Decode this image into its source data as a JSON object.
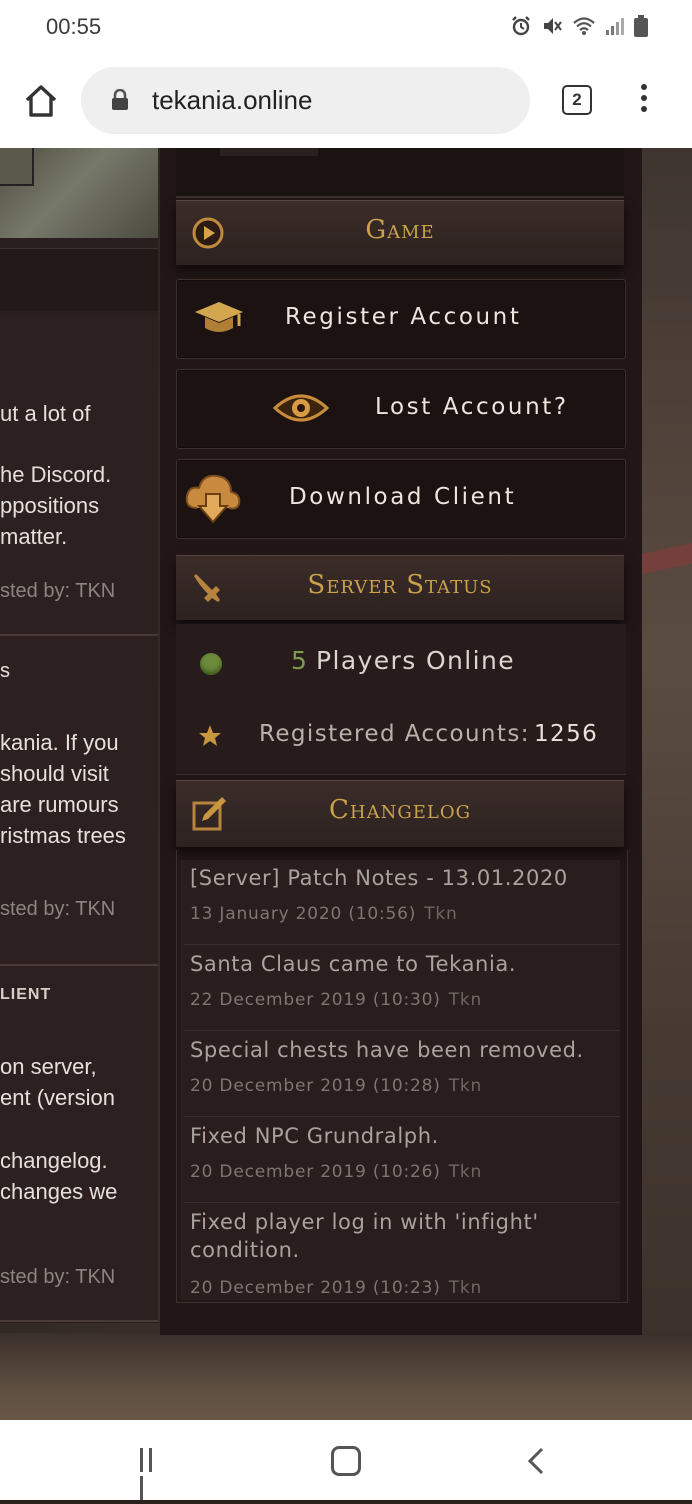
{
  "status_bar": {
    "time": "00:55",
    "icons": [
      "alarm-icon",
      "mute-icon",
      "wifi-icon",
      "signal-icon",
      "battery-icon"
    ]
  },
  "browser": {
    "url": "tekania.online",
    "tab_count": "2",
    "icons": [
      "home-icon",
      "lock-icon",
      "tabs-icon",
      "menu-icon"
    ]
  },
  "left_column": {
    "posts": [
      {
        "lines": [
          "ut a lot of",
          "he Discord.",
          "ppositions",
          " matter."
        ],
        "byline": "sted by: TKN"
      },
      {
        "title": "s",
        "lines": [
          "kania. If you",
          "should visit",
          "are rumours",
          "ristmas trees"
        ],
        "byline": "sted by: TKN"
      },
      {
        "title": "LIENT",
        "lines": [
          "on server,",
          "ent (version",
          "changelog.",
          "changes we"
        ],
        "byline": "sted by: TKN"
      }
    ]
  },
  "sidebar": {
    "game": {
      "title": "Game",
      "buttons": [
        {
          "label": "Register Account",
          "icon": "graduation-cap-icon"
        },
        {
          "label": "Lost Account?",
          "icon": "eye-icon"
        },
        {
          "label": "Download Client",
          "icon": "cloud-download-icon"
        }
      ]
    },
    "server_status": {
      "title": "Server Status",
      "players_count": "5",
      "players_label": "Players Online",
      "registered_label": "Registered Accounts:",
      "registered_count": "1256",
      "status_color": "#6b8a3a"
    },
    "changelog": {
      "title": "Changelog",
      "items": [
        {
          "title": "[Server] Patch Notes - 13.01.2020",
          "date": "13 January 2020 (10:56)",
          "author": "Tkn"
        },
        {
          "title": "Santa Claus came to Tekania.",
          "date": "22 December 2019 (10:30)",
          "author": "Tkn"
        },
        {
          "title": "Special chests have been removed.",
          "date": "20 December 2019 (10:28)",
          "author": "Tkn"
        },
        {
          "title": "Fixed NPC Grundralph.",
          "date": "20 December 2019 (10:26)",
          "author": "Tkn"
        },
        {
          "title": "Fixed player log in with 'infight' condition.",
          "date": "20 December 2019 (10:23)",
          "author": "Tkn"
        }
      ]
    },
    "accent_color": "#c9a24b"
  },
  "nav_bar": {
    "icons": [
      "recent-apps-icon",
      "home-button-icon",
      "back-icon"
    ]
  }
}
